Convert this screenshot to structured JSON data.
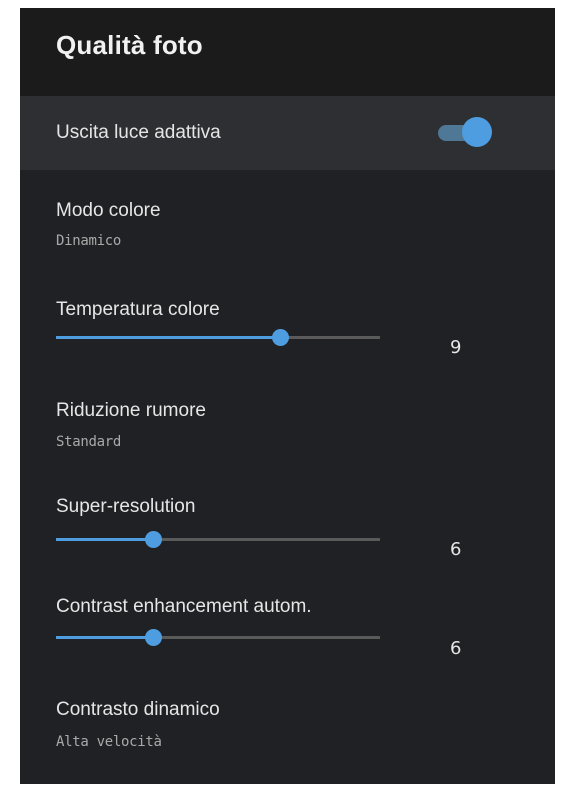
{
  "header": {
    "title": "Qualità foto"
  },
  "settings": {
    "adaptive_light": {
      "label": "Uscita luce adattiva",
      "enabled": true
    },
    "color_mode": {
      "label": "Modo colore",
      "value": "Dinamico"
    },
    "color_temperature": {
      "label": "Temperatura colore",
      "value": "9",
      "fraction": 0.69
    },
    "noise_reduction": {
      "label": "Riduzione rumore",
      "value": "Standard"
    },
    "super_resolution": {
      "label": "Super-resolution",
      "value": "6",
      "fraction": 0.3
    },
    "contrast_enhancement": {
      "label": "Contrast enhancement autom.",
      "value": "6",
      "fraction": 0.3
    },
    "dynamic_contrast": {
      "label": "Contrasto dinamico",
      "value": "Alta velocità"
    }
  },
  "colors": {
    "panel_background": "#202124",
    "header_background": "#1b1b1b",
    "selected_row": "#2d2f33",
    "accent": "#4e9de0",
    "rail": "#5a5a5a"
  }
}
